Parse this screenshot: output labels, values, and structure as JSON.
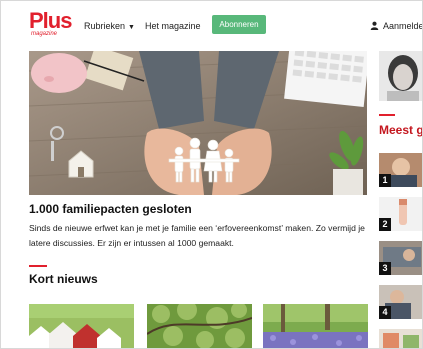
{
  "header": {
    "logo": "Plus",
    "logo_sub": "magazine",
    "nav": {
      "rubrieken": "Rubrieken",
      "magazine": "Het magazine"
    },
    "subscribe_button": "Abonneren",
    "login": "Aanmelden"
  },
  "main": {
    "headline": "1.000 familiepacten gesloten",
    "summary": "Sinds de nieuwe erfwet kan je met je familie een ‘erfovereenkomst’ maken. Zo vermijd je latere discussies. Er zijn er intussen al 1000 gemaakt.",
    "section_title": "Kort nieuws"
  },
  "sidebar": {
    "title": "Meest g",
    "items": [
      {
        "number": "1"
      },
      {
        "number": "2"
      },
      {
        "number": "3"
      },
      {
        "number": "4"
      }
    ]
  },
  "colors": {
    "brand_red": "#e1202d",
    "accent_green": "#58b87a"
  },
  "icons": {
    "caret": "chevron-down-icon",
    "user": "user-icon"
  }
}
